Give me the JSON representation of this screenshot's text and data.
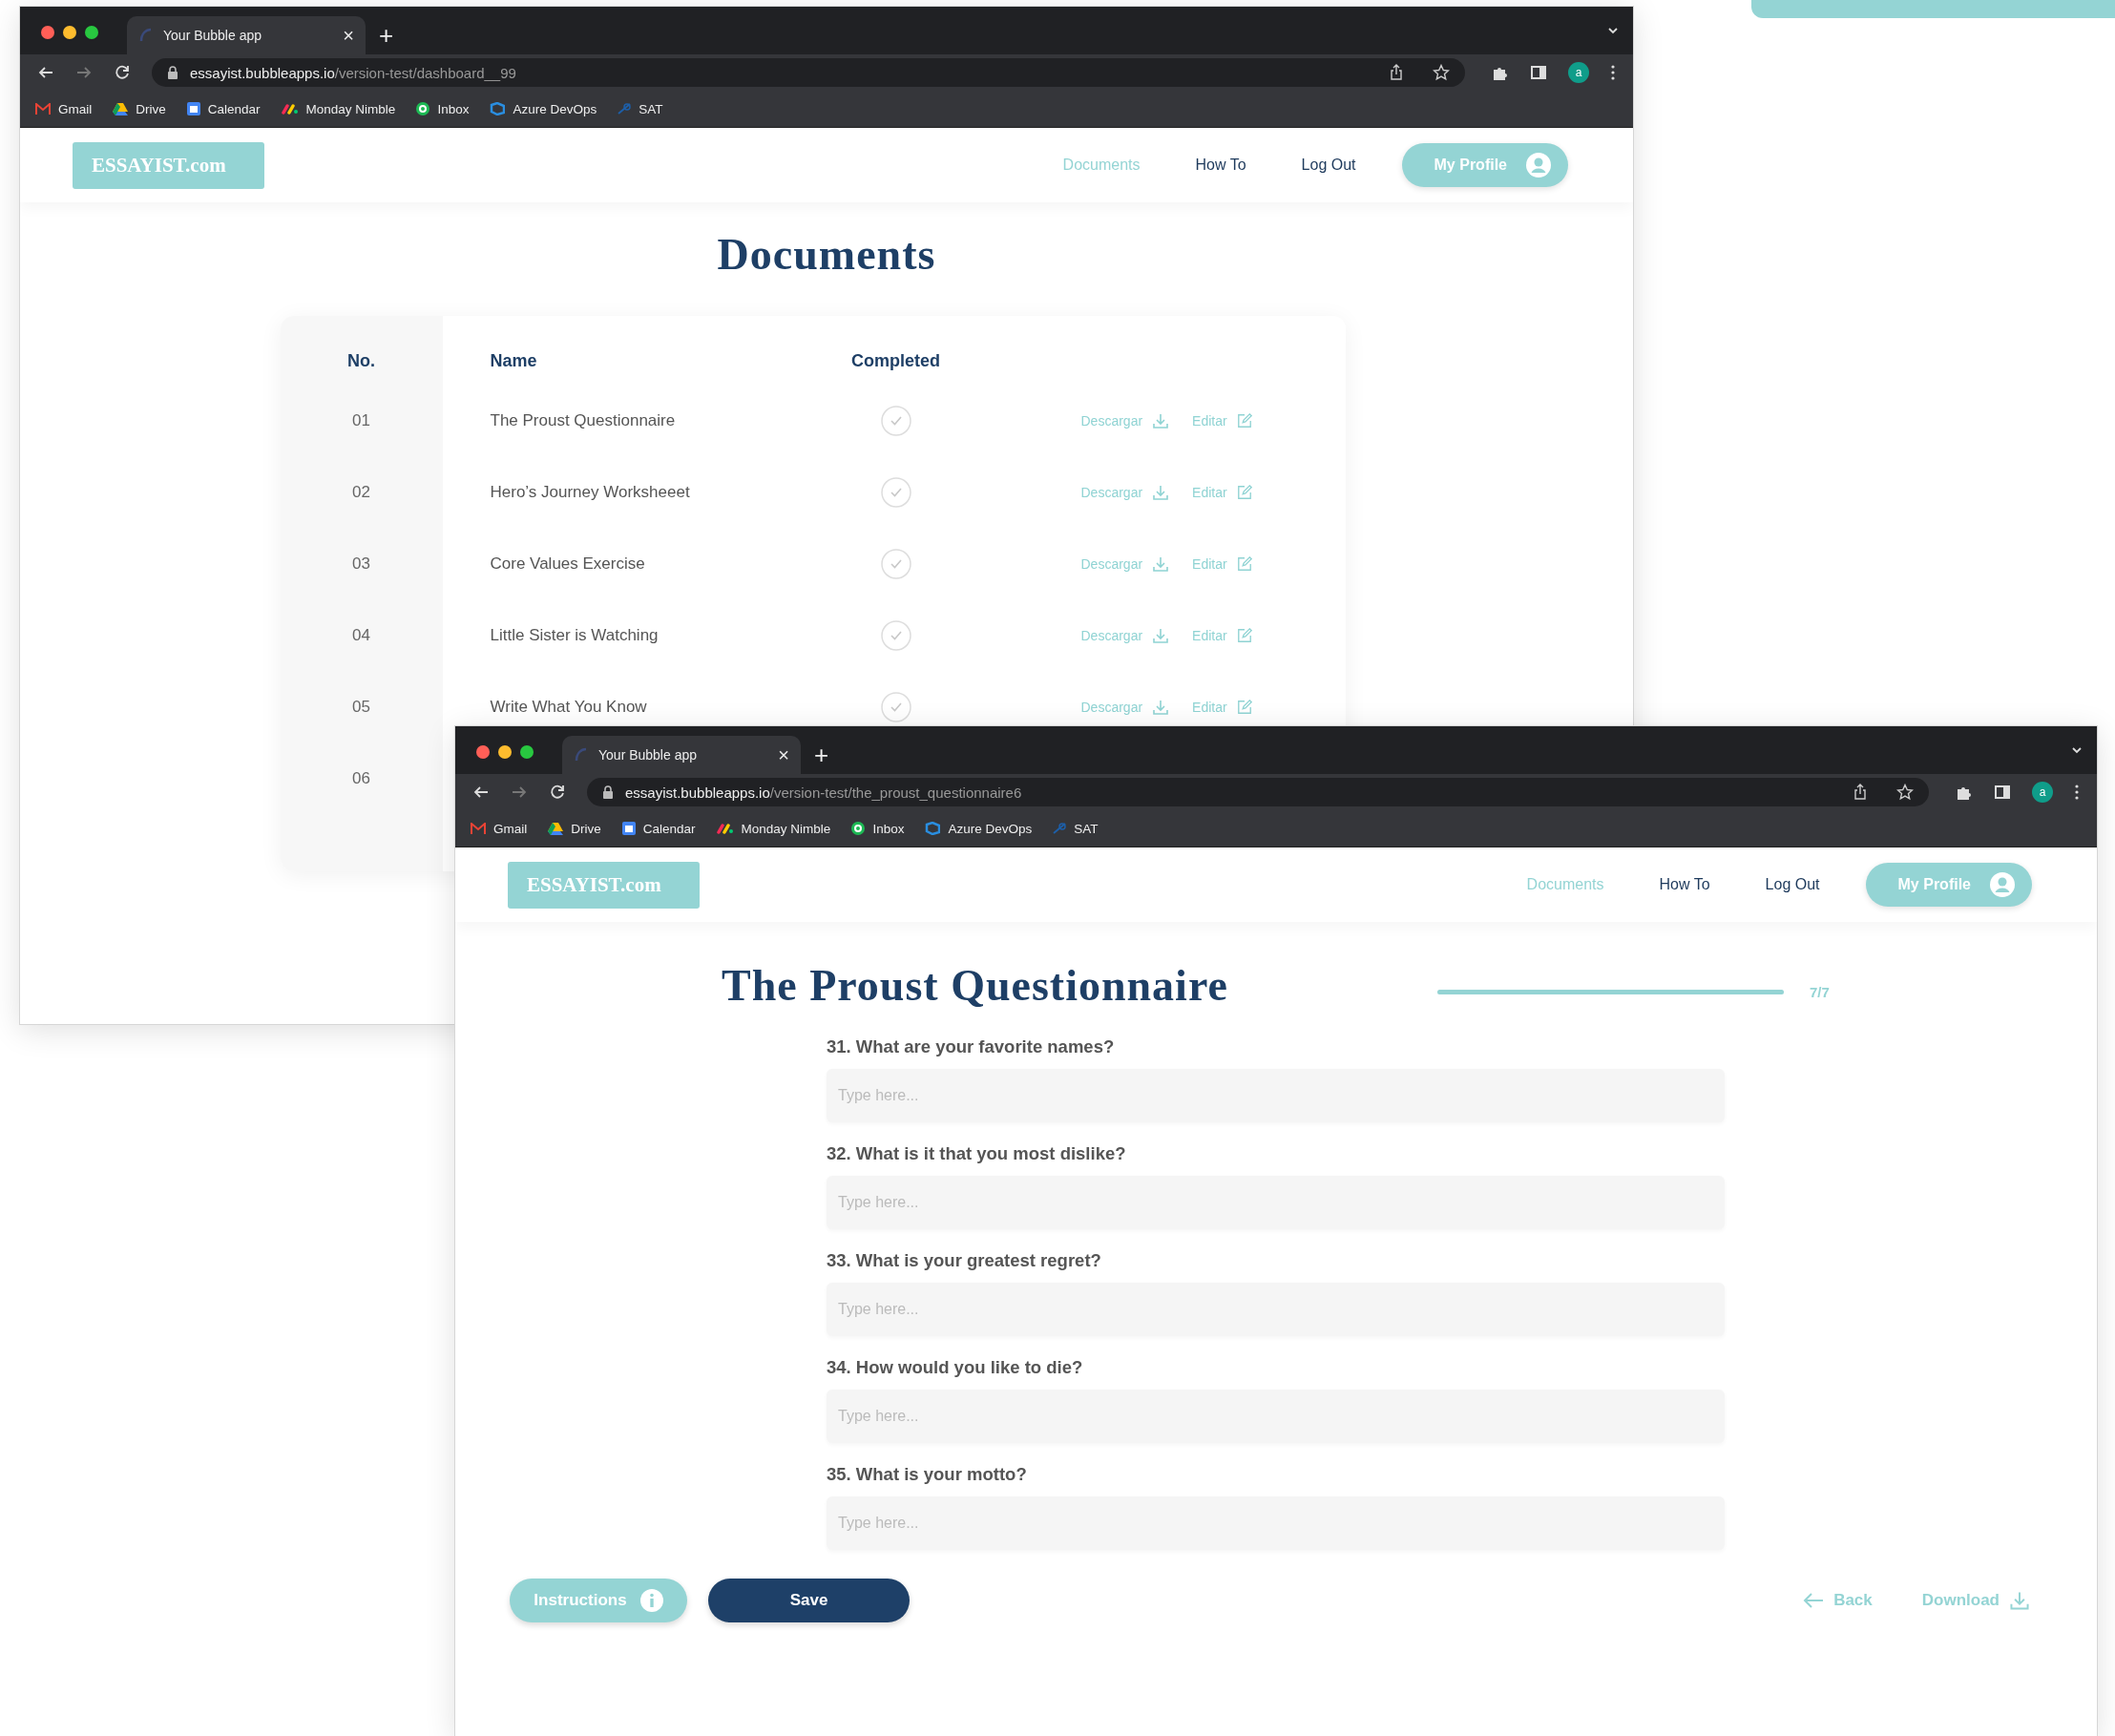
{
  "windows": [
    {
      "kind": "dashboard",
      "browser": {
        "tab_title": "Your Bubble app",
        "tab_close": "×",
        "new_tab": "+",
        "url_host": "essayist.bubbleapps.io",
        "url_path": "/version-test/dashboard__99",
        "profile_initial": "a",
        "bookmarks": [
          "Gmail",
          "Drive",
          "Calendar",
          "Monday Nimble",
          "Inbox",
          "Azure DevOps",
          "SAT"
        ]
      },
      "header": {
        "logo": "ESSAYIST.com",
        "nav": [
          {
            "label": "Documents",
            "selected": true
          },
          {
            "label": "How To",
            "selected": false
          },
          {
            "label": "Log Out",
            "selected": false
          }
        ],
        "profile_button": "My Profile"
      },
      "page": {
        "title": "Documents",
        "table": {
          "columns": [
            "No.",
            "Name",
            "Completed"
          ],
          "rows": [
            {
              "number": "01",
              "name": "The Proust Questionnaire",
              "completed": true,
              "download": "Descargar",
              "edit": "Editar"
            },
            {
              "number": "02",
              "name": "Hero’s Journey Worksheeet",
              "completed": true,
              "download": "Descargar",
              "edit": "Editar"
            },
            {
              "number": "03",
              "name": "Core Values Exercise",
              "completed": true,
              "download": "Descargar",
              "edit": "Editar"
            },
            {
              "number": "04",
              "name": "Little Sister is Watching",
              "completed": true,
              "download": "Descargar",
              "edit": "Editar"
            },
            {
              "number": "05",
              "name": "Write What You Know",
              "completed": true,
              "download": "Descargar",
              "edit": "Editar"
            },
            {
              "number": "06"
            }
          ]
        }
      }
    },
    {
      "kind": "questionnaire",
      "browser": {
        "tab_title": "Your Bubble app",
        "tab_close": "×",
        "new_tab": "+",
        "url_host": "essayist.bubbleapps.io",
        "url_path": "/version-test/the_proust_questionnaire6",
        "profile_initial": "a",
        "bookmarks": [
          "Gmail",
          "Drive",
          "Calendar",
          "Monday Nimble",
          "Inbox",
          "Azure DevOps",
          "SAT"
        ]
      },
      "header": {
        "logo": "ESSAYIST.com",
        "nav": [
          {
            "label": "Documents",
            "selected": true
          },
          {
            "label": "How To",
            "selected": false
          },
          {
            "label": "Log Out",
            "selected": false
          }
        ],
        "profile_button": "My Profile"
      },
      "page": {
        "title": "The Proust Questionnaire",
        "progress": {
          "level": 1,
          "reading": "7/7"
        },
        "questions": [
          {
            "label": "31. What are your favorite names?",
            "placeholder": "Type here..."
          },
          {
            "label": "32. What is it that you most dislike?",
            "placeholder": "Type here..."
          },
          {
            "label": "33. What is your greatest regret?",
            "placeholder": "Type here..."
          },
          {
            "label": "34. How would you like to die?",
            "placeholder": "Type here..."
          },
          {
            "label": "35. What is your motto?",
            "placeholder": "Type here..."
          }
        ],
        "actions": [
          {
            "label": "Instructions",
            "kind": "instructions"
          },
          {
            "label": "Save",
            "kind": "save"
          },
          {
            "label": "Back",
            "kind": "back"
          },
          {
            "label": "Download",
            "kind": "download"
          }
        ]
      }
    }
  ]
}
